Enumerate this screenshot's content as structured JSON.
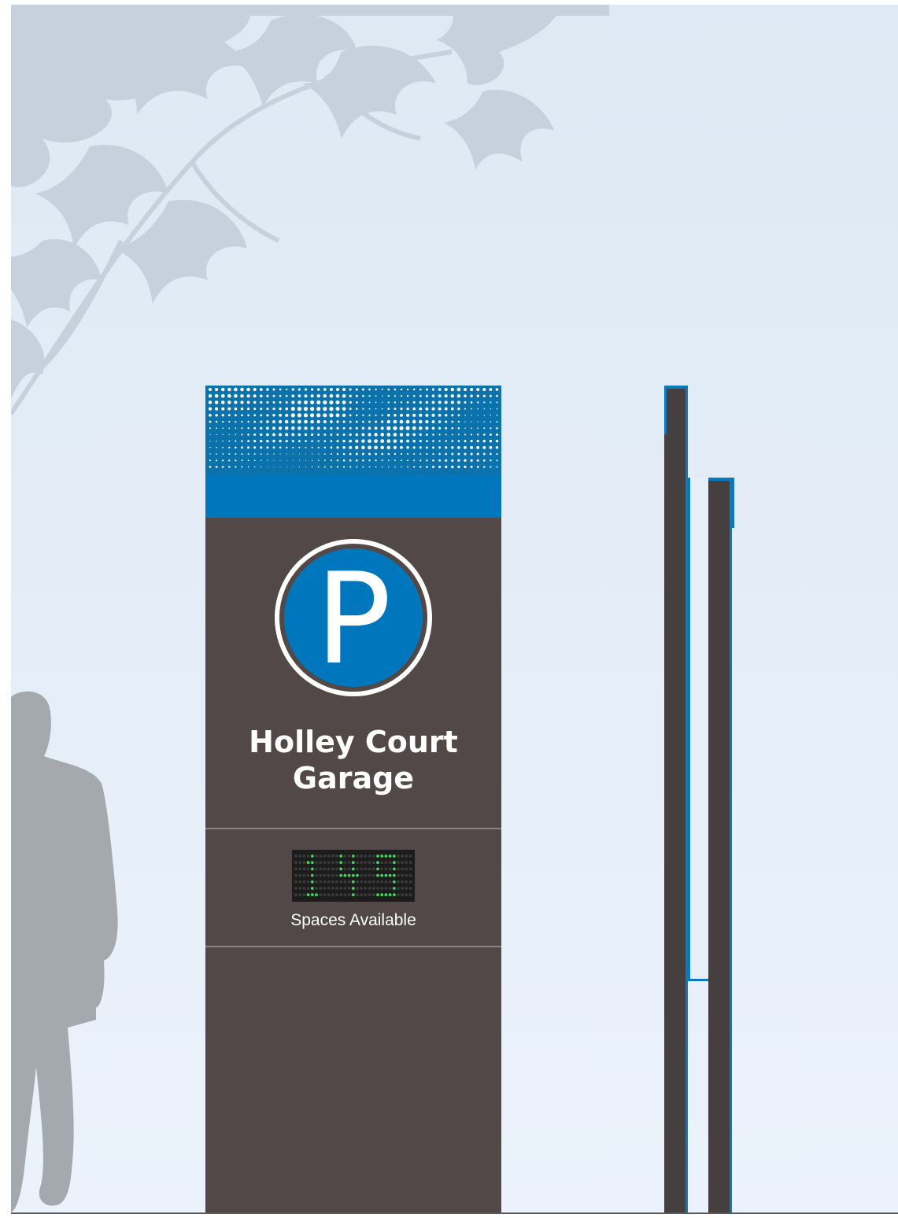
{
  "sign": {
    "title_line1": "Holley Court",
    "title_line2": "Garage",
    "parking_symbol": "P",
    "spaces_count": "149",
    "spaces_label": "Spaces Available"
  },
  "colors": {
    "sky": "#e4edf7",
    "brand_blue": "#0077bd",
    "cabinet": "#524848",
    "led_green": "#3fd35a",
    "silhouette": "#a3a9ad"
  },
  "icons": {
    "parking": "parking-icon",
    "person": "person-silhouette",
    "foliage": "tree-branch-silhouette"
  }
}
